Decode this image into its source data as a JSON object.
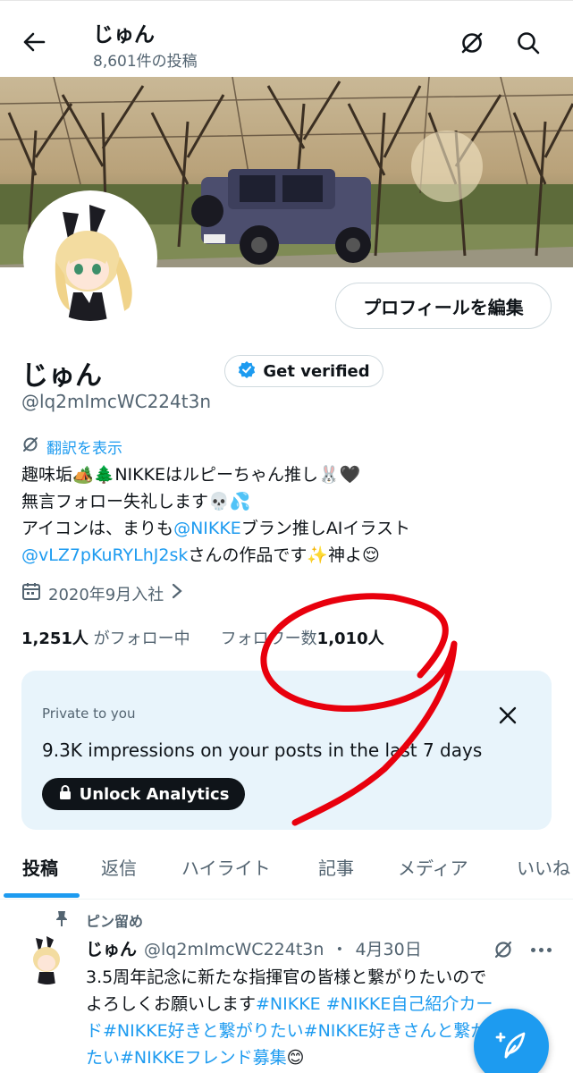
{
  "header": {
    "title": "じゅん",
    "post_count": "8,601件の投稿"
  },
  "profile": {
    "edit_button": "プロフィールを編集",
    "display_name": "じゅん",
    "verified_button": "Get verified",
    "handle": "@lq2mImcWC224t3n",
    "translate_link": "翻訳を表示",
    "bio": {
      "line1": "趣味垢🏕️🌲NIKKEはルピーちゃん推し🐰🖤",
      "line2": "無言フォロー失礼します💀💦",
      "line3_prefix": "アイコンは、まりも",
      "line3_link": "@NIKKE",
      "line3_suffix": "ブラン推しAIイラスト",
      "line4_link": "@vLZ7pKuRYLhJ2sk",
      "line4_suffix": "さんの作品です✨神よ😌"
    },
    "joined": "2020年9月入社",
    "following_count": "1,251人",
    "following_label": "がフォロー中",
    "followers_label": "フォロワー数",
    "followers_count": "1,010人"
  },
  "analytics": {
    "private_label": "Private to you",
    "impressions": "9.3K impressions on your posts in the last 7 days",
    "unlock_button": "Unlock Analytics"
  },
  "tabs": [
    "投稿",
    "返信",
    "ハイライト",
    "記事",
    "メディア",
    "いいね"
  ],
  "pinned_post": {
    "pinned_label": "ピン留め",
    "name": "じゅん",
    "handle": "@lq2mImcWC224t3n",
    "dot": "・",
    "date": "4月30日",
    "text_line1": "3.5周年記念に新たな指揮官の皆様と繋がりたいので",
    "text_line2_prefix": "よろしくお願いします",
    "text_line2_tags": "#NIKKE #NIKKE自己紹介カー",
    "text_line3_tags": "ド#NIKKE好きと繋がりたい#NIKKE好きさんと繋がり",
    "text_line4_tags": "たい#NIKKEフレンド募集",
    "text_line4_suffix": "😊"
  },
  "colors": {
    "accent": "#1d9bf0",
    "text": "#0f1419",
    "muted": "#536471",
    "card_bg": "#e8f4fb",
    "scribble": "#e8000d"
  },
  "icons": [
    "back-arrow-icon",
    "translate-icon",
    "search-icon",
    "verified-badge-icon",
    "calendar-icon",
    "chevron-right-icon",
    "close-icon",
    "lock-icon",
    "pin-icon",
    "more-icon",
    "compose-icon"
  ]
}
